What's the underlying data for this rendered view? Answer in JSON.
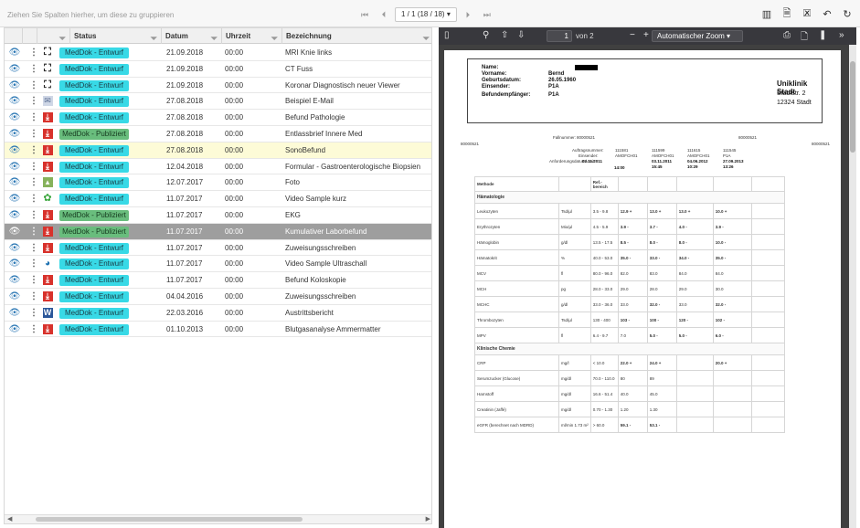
{
  "toolbar": {
    "group_hint": "Ziehen Sie Spalten hierher, um diese zu gruppieren",
    "pager": {
      "first": "⏮",
      "prev": "⏴",
      "current": "1 / 1 (18 / 18)",
      "next": "⏵",
      "last": "⏭"
    },
    "icons": [
      "panel-icon",
      "pdf-export-icon",
      "excel-export-icon",
      "undo-icon",
      "refresh-icon"
    ]
  },
  "grid": {
    "columns": {
      "status": "Status",
      "date": "Datum",
      "time": "Uhrzeit",
      "desc": "Bezeichnung"
    },
    "rows": [
      {
        "type": "xray",
        "status": "MedDok - Entwurf",
        "state": "draft",
        "date": "21.09.2018",
        "time": "00:00",
        "desc": "MRI Knie links"
      },
      {
        "type": "xray",
        "status": "MedDok - Entwurf",
        "state": "draft",
        "date": "21.09.2018",
        "time": "00:00",
        "desc": "CT Fuss"
      },
      {
        "type": "xray",
        "status": "MedDok - Entwurf",
        "state": "draft",
        "date": "21.09.2018",
        "time": "00:00",
        "desc": "Koronar Diagnostisch neuer Viewer"
      },
      {
        "type": "mail",
        "status": "MedDok - Entwurf",
        "state": "draft",
        "date": "27.08.2018",
        "time": "00:00",
        "desc": "Beispiel E-Mail"
      },
      {
        "type": "pdf",
        "status": "MedDok - Entwurf",
        "state": "draft",
        "date": "27.08.2018",
        "time": "00:00",
        "desc": "Befund Pathologie"
      },
      {
        "type": "pdf",
        "status": "MedDok - Publiziert",
        "state": "pub",
        "date": "27.08.2018",
        "time": "00:00",
        "desc": "Entlassbrief Innere Med"
      },
      {
        "type": "pdf",
        "status": "MedDok - Entwurf",
        "state": "draft",
        "date": "27.08.2018",
        "time": "00:00",
        "desc": "SonoBefund",
        "highlight": "yellow"
      },
      {
        "type": "pdf",
        "status": "MedDok - Entwurf",
        "state": "draft",
        "date": "12.04.2018",
        "time": "00:00",
        "desc": "Formular - Gastroenterologische Biopsien"
      },
      {
        "type": "photo",
        "status": "MedDok - Entwurf",
        "state": "draft",
        "date": "12.07.2017",
        "time": "00:00",
        "desc": "Foto"
      },
      {
        "type": "video",
        "status": "MedDok - Entwurf",
        "state": "draft",
        "date": "11.07.2017",
        "time": "00:00",
        "desc": "Video Sample kurz"
      },
      {
        "type": "pdf",
        "status": "MedDok - Publiziert",
        "state": "pub",
        "date": "11.07.2017",
        "time": "00:00",
        "desc": "EKG"
      },
      {
        "type": "pdf",
        "status": "MedDok - Publiziert",
        "state": "pub",
        "date": "11.07.2017",
        "time": "00:00",
        "desc": "Kumulativer Laborbefund",
        "highlight": "gray"
      },
      {
        "type": "pdf",
        "status": "MedDok - Entwurf",
        "state": "draft",
        "date": "11.07.2017",
        "time": "00:00",
        "desc": "Zuweisungsschreiben"
      },
      {
        "type": "endo",
        "status": "MedDok - Entwurf",
        "state": "draft",
        "date": "11.07.2017",
        "time": "00:00",
        "desc": "Video Sample Ultraschall"
      },
      {
        "type": "pdf",
        "status": "MedDok - Entwurf",
        "state": "draft",
        "date": "11.07.2017",
        "time": "00:00",
        "desc": "Befund Koloskopie"
      },
      {
        "type": "pdf",
        "status": "MedDok - Entwurf",
        "state": "draft",
        "date": "04.04.2016",
        "time": "00:00",
        "desc": "Zuweisungsschreiben"
      },
      {
        "type": "word",
        "status": "MedDok - Entwurf",
        "state": "draft",
        "date": "22.03.2016",
        "time": "00:00",
        "desc": "Austrittsbericht"
      },
      {
        "type": "pdf",
        "status": "MedDok - Entwurf",
        "state": "draft",
        "date": "01.10.2013",
        "time": "00:00",
        "desc": "Blutgasanalyse Ammermatter"
      }
    ]
  },
  "viewer": {
    "page_input": "1",
    "page_of": "von 2",
    "zoom": "Automatischer Zoom",
    "doc": {
      "address": {
        "name_label": "Name:",
        "vorname_label": "Vorname:",
        "vorname": "Bernd",
        "geb_label": "Geburtsdatum:",
        "geb": "26.05.1960",
        "einsender_label": "Einsender:",
        "einsender": "P1A",
        "empf_label": "Befundempfänger:",
        "empf": "P1A",
        "clinic": "Uniklinik Stadt",
        "street": "Stadtstr. 2",
        "city": "12324 Stadt"
      },
      "fall_label": "Fallnummer:",
      "fall_no": "80000521",
      "left_no": "80000521",
      "right_no": "80000521",
      "right_no2": "80000521",
      "auftrag_label": "Auftragsnummer:",
      "einsender_label": "Einsender:",
      "anf_label": "Anforderungsdatum/-zeit:",
      "orders": [
        {
          "no": "111581",
          "sender": "AMOFCH01",
          "date": "03.11.2011",
          "time": "14:00"
        },
        {
          "no": "111599",
          "sender": "AMOFCH01",
          "date": "03.11.2011",
          "time": "15:45"
        },
        {
          "no": "111615",
          "sender": "AMOFCH01",
          "date": "04.06.2012",
          "time": "10:29"
        },
        {
          "no": "111545",
          "sender": "P1A",
          "date": "27.09.2013",
          "time": "13:26"
        }
      ],
      "table": {
        "h_method": "Methode",
        "h_ref": "Ref.-",
        "h_ref2": "bereich",
        "sections": [
          {
            "title": "Hämatologie",
            "rows": [
              {
                "m": "Leukozyten",
                "u": "Tsd/µl",
                "r": "3.5 - 9.8",
                "v": [
                  "12.9 +",
                  "13.0 +",
                  "13.0 +",
                  "10.0 +"
                ],
                "b": [
                  true,
                  true,
                  true,
                  true
                ]
              },
              {
                "m": "Erythrozyten",
                "u": "Mio/µl",
                "r": "4.5 - 5.9",
                "v": [
                  "3.9 -",
                  "3.7 -",
                  "4.0 -",
                  "3.9 -"
                ],
                "b": [
                  true,
                  true,
                  true,
                  true
                ]
              },
              {
                "m": "Hämoglobin",
                "u": "g/dl",
                "r": "13.5 - 17.5",
                "v": [
                  "8.5 -",
                  "8.0 -",
                  "8.0 -",
                  "10.0 -"
                ],
                "b": [
                  true,
                  true,
                  true,
                  true
                ]
              },
              {
                "m": "Hämatokrit",
                "u": "%",
                "r": "40.0 - 53.0",
                "v": [
                  "35.0 -",
                  "33.0 -",
                  "34.0 -",
                  "35.0 -"
                ],
                "b": [
                  true,
                  true,
                  true,
                  true
                ]
              },
              {
                "m": "MCV",
                "u": "fl",
                "r": "80.0 - 96.0",
                "v": [
                  "82.0",
                  "83.0",
                  "84.0",
                  "84.0"
                ],
                "b": [
                  false,
                  false,
                  false,
                  false
                ]
              },
              {
                "m": "MCH",
                "u": "pg",
                "r": "28.0 - 33.0",
                "v": [
                  "29.0",
                  "28.0",
                  "29.0",
                  "30.0"
                ],
                "b": [
                  false,
                  false,
                  false,
                  false
                ]
              },
              {
                "m": "MCHC",
                "u": "g/dl",
                "r": "33.0 - 36.0",
                "v": [
                  "33.0",
                  "32.0 -",
                  "33.0",
                  "32.0 -"
                ],
                "b": [
                  false,
                  true,
                  false,
                  true
                ]
              },
              {
                "m": "Thrombozyten",
                "u": "Tsd/µl",
                "r": "130 - 400",
                "v": [
                  "103 -",
                  "100 -",
                  "120 -",
                  "102 -"
                ],
                "b": [
                  true,
                  true,
                  true,
                  true
                ]
              },
              {
                "m": "MPV",
                "u": "fl",
                "r": "6.4 - 9.7",
                "v": [
                  "7.0",
                  "5.0 -",
                  "5.0 -",
                  "6.0 -"
                ],
                "b": [
                  false,
                  true,
                  true,
                  true
                ]
              }
            ]
          },
          {
            "title": "Klinische Chemie",
            "rows": [
              {
                "m": "CRP",
                "u": "mg/l",
                "r": "< 10.0",
                "v": [
                  "22.0 +",
                  "24.0 +",
                  "",
                  "20.0 +"
                ],
                "b": [
                  true,
                  true,
                  false,
                  true
                ]
              },
              {
                "m": "Serumzucker (Glucose)",
                "u": "mg/dl",
                "r": "70.0 - 110.0",
                "v": [
                  "80",
                  "89",
                  "",
                  ""
                ],
                "b": [
                  false,
                  false,
                  false,
                  false
                ]
              },
              {
                "m": "Harnstoff",
                "u": "mg/dl",
                "r": "16.6 - 51.4",
                "v": [
                  "40.0",
                  "45.0",
                  "",
                  ""
                ],
                "b": [
                  false,
                  false,
                  false,
                  false
                ]
              },
              {
                "m": "Creatinin (Jaffé)",
                "u": "mg/dl",
                "r": "0.70 - 1.30",
                "v": [
                  "1.20",
                  "1.30",
                  "",
                  ""
                ],
                "b": [
                  false,
                  false,
                  false,
                  false
                ]
              },
              {
                "m": "eGFR (berechnet nach MDRD)",
                "u": "ml/min 1.73 m²",
                "r": "> 60.0",
                "v": [
                  "59.1 -",
                  "53.1 -",
                  "",
                  ""
                ],
                "b": [
                  true,
                  true,
                  false,
                  false
                ]
              }
            ]
          }
        ]
      }
    }
  },
  "colors": {
    "draft": "#38d9e6",
    "published": "#69bd7d",
    "selected_yellow": "#fdfbd7",
    "selected_gray": "#9e9e9e",
    "viewer_bg": "#404040"
  }
}
